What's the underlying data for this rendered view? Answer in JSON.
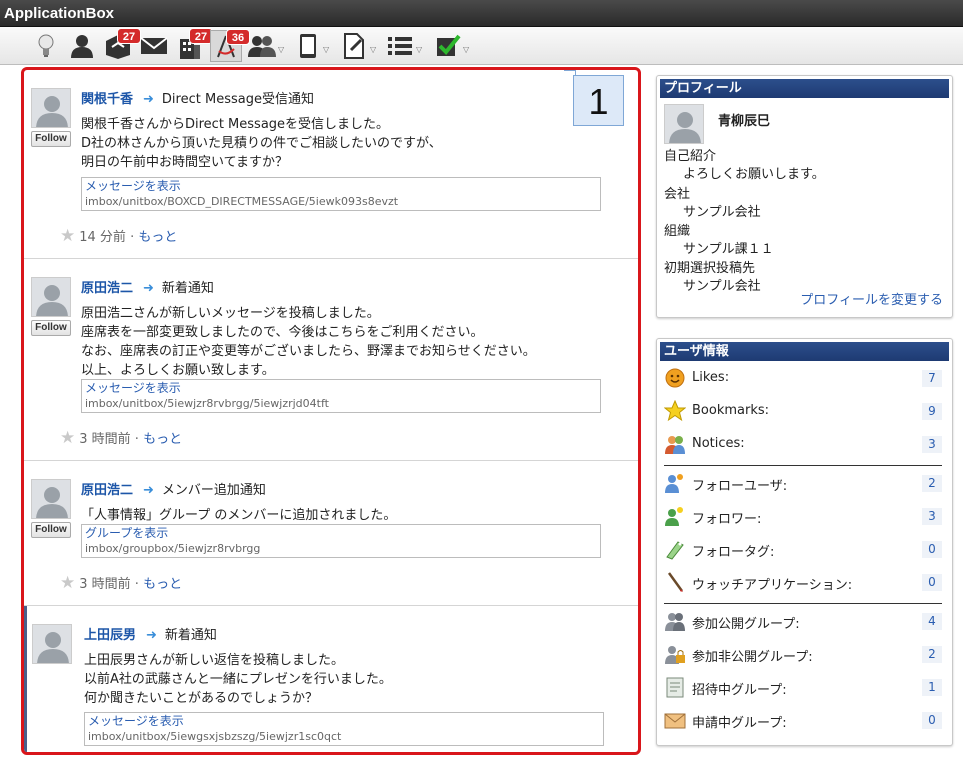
{
  "window": {
    "title": "ApplicationBox"
  },
  "toolbar": {
    "items": [
      {
        "icon": "lightbulb-icon"
      },
      {
        "icon": "person-icon"
      },
      {
        "icon": "box-icon",
        "badge": "27"
      },
      {
        "icon": "mail-icon"
      },
      {
        "icon": "building-icon",
        "badge": "27"
      },
      {
        "icon": "compass-icon",
        "badge": "36"
      },
      {
        "icon": "users-icon"
      },
      {
        "icon": "tablet-icon"
      },
      {
        "icon": "pin-document-icon"
      },
      {
        "icon": "list-icon"
      },
      {
        "icon": "checkbox-icon"
      }
    ]
  },
  "callout": {
    "number": "1"
  },
  "feed": {
    "follow_label": "Follow",
    "entries": [
      {
        "author": "関根千香",
        "type": "Direct Message受信通知",
        "lines": [
          "関根千香さんからDirect Messageを受信しました。",
          "D社の林さんから頂いた見積りの件でご相談したいのですが、",
          "明日の午前中お時間空いてますか？"
        ],
        "link_text": "メッセージを表示",
        "link_url": "imbox/unitbox/BOXCD_DIRECTMESSAGE/5iewk093s8evzt",
        "time": "14 分前",
        "more": "もっと"
      },
      {
        "author": "原田浩二",
        "type": "新着通知",
        "lines": [
          "原田浩二さんが新しいメッセージを投稿しました。",
          "座席表を一部変更致しましたので、今後はこちらをご利用ください。",
          "なお、座席表の訂正や変更等がございましたら、野澤までお知らせください。",
          "以上、よろしくお願い致します。"
        ],
        "link_text": "メッセージを表示",
        "link_url": "imbox/unitbox/5iewjzr8rvbrgg/5iewjzrjd04tft",
        "time": "3 時間前",
        "more": "もっと"
      },
      {
        "author": "原田浩二",
        "type": "メンバー追加通知",
        "lines": [
          "「人事情報」グループ のメンバーに追加されました。"
        ],
        "link_text": "グループを表示",
        "link_url": "imbox/groupbox/5iewjzr8rvbrgg",
        "time": "3 時間前",
        "more": "もっと"
      },
      {
        "author": "上田辰男",
        "type": "新着通知",
        "lines": [
          "上田辰男さんが新しい返信を投稿しました。",
          "以前A社の武藤さんと一緒にプレゼンを行いました。",
          "何か聞きたいことがあるのでしょうか？"
        ],
        "link_text": "メッセージを表示",
        "link_url": "imbox/unitbox/5iewgsxjsbzszg/5iewjzr1sc0qct"
      }
    ]
  },
  "profile": {
    "title": "プロフィール",
    "name": "青柳辰巳",
    "intro_label": "自己紹介",
    "intro_value": "よろしくお願いします。",
    "company_label": "会社",
    "company_value": "サンプル会社",
    "org_label": "組織",
    "org_value": "サンプル課１１",
    "default_label": "初期選択投稿先",
    "default_value": "サンプル会社",
    "edit_link": "プロフィールを変更する"
  },
  "user_info": {
    "title": "ユーザ情報",
    "group1": [
      {
        "label": "Likes:",
        "count": "7",
        "icon": "smiley-icon"
      },
      {
        "label": "Bookmarks:",
        "count": "9",
        "icon": "star-icon"
      },
      {
        "label": "Notices:",
        "count": "3",
        "icon": "people-icon"
      }
    ],
    "group2": [
      {
        "label": "フォローユーザ:",
        "count": "2",
        "icon": "follow-user-icon"
      },
      {
        "label": "フォロワー:",
        "count": "3",
        "icon": "follower-icon"
      },
      {
        "label": "フォロータグ:",
        "count": "0",
        "icon": "tag-icon"
      },
      {
        "label": "ウォッチアプリケーション:",
        "count": "0",
        "icon": "pencil-icon"
      }
    ],
    "group3": [
      {
        "label": "参加公開グループ:",
        "count": "4",
        "icon": "public-group-icon"
      },
      {
        "label": "参加非公開グループ:",
        "count": "2",
        "icon": "private-group-icon"
      },
      {
        "label": "招待中グループ:",
        "count": "1",
        "icon": "invite-icon"
      },
      {
        "label": "申請中グループ:",
        "count": "0",
        "icon": "request-icon"
      }
    ]
  }
}
